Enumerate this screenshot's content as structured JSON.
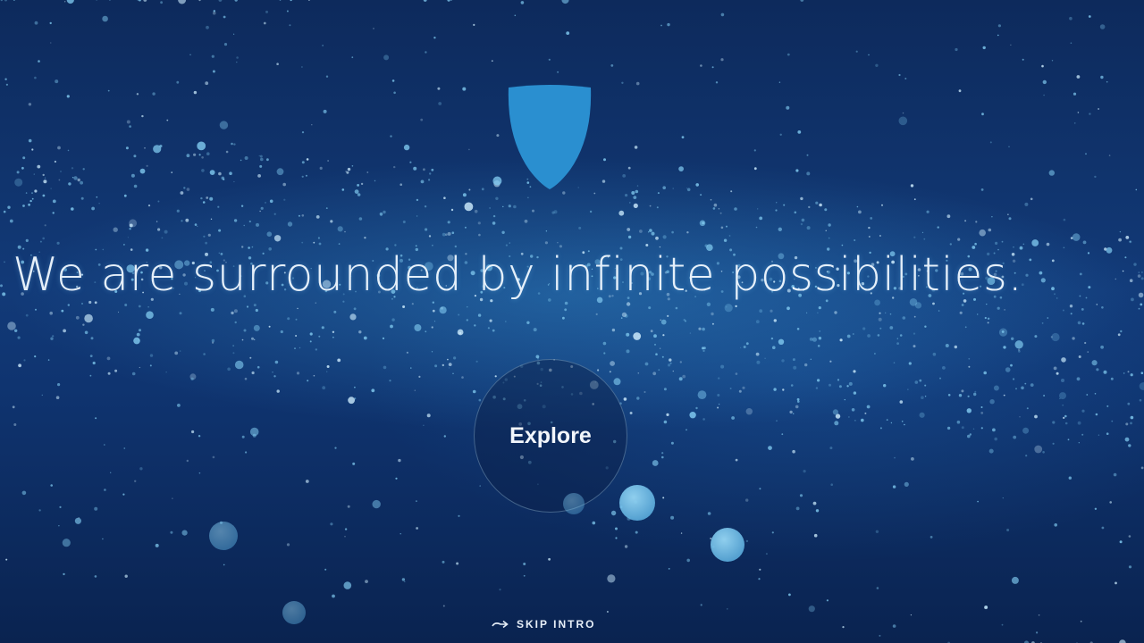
{
  "intro": {
    "headline": "We are surrounded by infinite possibilities.",
    "explore_label": "Explore",
    "skip_label": "SKIP INTRO"
  },
  "icons": {
    "logo": "shield-icon",
    "skip": "arrow-right-icon"
  },
  "colors": {
    "background_top": "#0d2a5c",
    "background_mid": "#123a78",
    "shield": "#2a8fd0",
    "particle": "#7fc8ee",
    "text": "#f0f8ff"
  }
}
